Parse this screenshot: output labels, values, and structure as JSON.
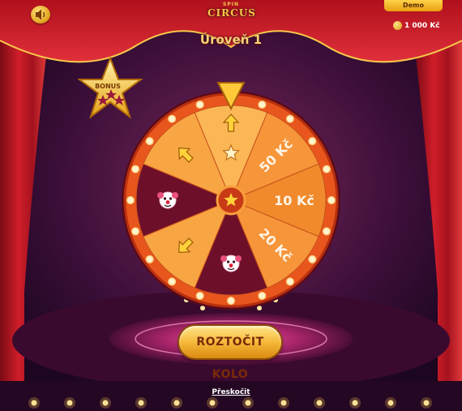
{
  "header": {
    "logo_top": "SPIN",
    "logo_main": "CIRCUS",
    "level_title": "Úroveň 1",
    "demo_label": "Demo",
    "balance": "1 000 Kč"
  },
  "bonus": {
    "label": "BONUS"
  },
  "wheel": {
    "segments": [
      {
        "kind": "arrow-up",
        "label": ""
      },
      {
        "kind": "prize",
        "label": "50 Kč"
      },
      {
        "kind": "prize",
        "label": "10 Kč"
      },
      {
        "kind": "prize",
        "label": "20 Kč"
      },
      {
        "kind": "clown",
        "label": ""
      },
      {
        "kind": "arrow-down-left",
        "label": ""
      },
      {
        "kind": "clown",
        "label": ""
      },
      {
        "kind": "arrow-up-left",
        "label": ""
      }
    ],
    "colors": {
      "rim": "#e8561e",
      "seg_light": "#f8a544",
      "seg_mid": "#f08a2c",
      "seg_dark": "#6e0f2a",
      "bulb": "#fff4d0",
      "pointer": "#ffc93a"
    }
  },
  "controls": {
    "spin_label": "ROZTOČIT KOLO",
    "skip_label": "Přeskočit"
  },
  "icons": [
    "sound-icon",
    "coin-icon",
    "bonus-star-icon",
    "wheel-pointer-icon",
    "center-star-icon",
    "arrow-icon",
    "clown-face-icon"
  ]
}
